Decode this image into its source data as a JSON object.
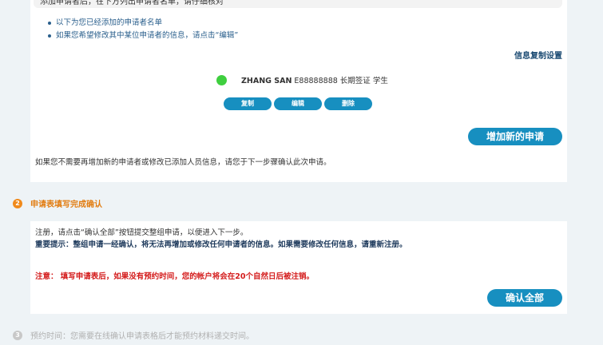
{
  "top_strip_text": "添加申请者后，在下方列出申请者名单，请仔细核对",
  "bullets": [
    "以下为您已经添加的申请者名单",
    "如果您希望修改其中某位申请者的信息，请点击“编辑”"
  ],
  "copy_settings_link": "信息复制设置",
  "applicant": {
    "name": "ZHANG SAN",
    "rest": " E88888888 长期签证 学生",
    "status_color": "#3fcf3f"
  },
  "row_actions": {
    "copy": "复制",
    "edit": "编辑",
    "delete": "删除"
  },
  "add_application_button": "增加新的申请",
  "no_more_note": "如果您不需要再增加新的申请者或修改已添加人员信息，请您于下一步骤确认此次申请。",
  "step2": {
    "number": "2",
    "label": "申请表填写完成确认"
  },
  "confirm_panel": {
    "line1": "注册，请点击“确认全部”按钮提交整组申请，以便进入下一步。",
    "line2": "重要提示：整组申请一经确认，将无法再增加或修改任何申请者的信息。如果需要修改任何信息，请重新注册。",
    "line3": "注意： 填写申请表后，如果没有预约时间，您的帐户将会在20个自然日后被注销。",
    "confirm_all_button": "确认全部"
  },
  "step3": {
    "number": "3",
    "label": "预约时间：您需要在线确认申请表格后才能预约材料递交时间。"
  },
  "colors": {
    "accent": "#178fc0",
    "step_active": "#f08a1c",
    "warning": "#d41c1c"
  }
}
